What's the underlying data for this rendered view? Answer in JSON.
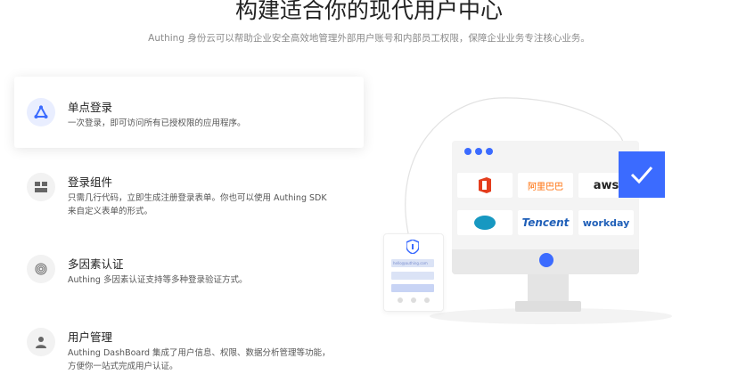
{
  "header": {
    "title": "构建适合你的现代用户中心",
    "subtitle": "Authing 身份云可以帮助企业安全高效地管理外部用户账号和内部员工权限，保障企业业务专注核心业务。"
  },
  "features": [
    {
      "title": "单点登录",
      "desc": "一次登录，即可访问所有已授权限的应用程序。",
      "icon": "sso-icon",
      "active": true
    },
    {
      "title": "登录组件",
      "desc": "只需几行代码，立即生成注册登录表单。你也可以使用 Authing SDK 来自定义表单的形式。",
      "icon": "login-widget-icon",
      "active": false
    },
    {
      "title": "多因素认证",
      "desc": "Authing 多因素认证支持等多种登录验证方式。",
      "icon": "fingerprint-icon",
      "active": false
    },
    {
      "title": "用户管理",
      "desc": "Authing DashBoard 集成了用户信息、权限、数据分析管理等功能，方便你一站式完成用户认证。",
      "icon": "user-icon",
      "active": false
    }
  ],
  "illustration": {
    "logos": [
      "office-icon",
      "阿里巴巴",
      "aws",
      "salesforce",
      "Tencent",
      "workday"
    ],
    "accent_color": "#3b6bff",
    "phone_email_placeholder": "hello@authing.com"
  }
}
